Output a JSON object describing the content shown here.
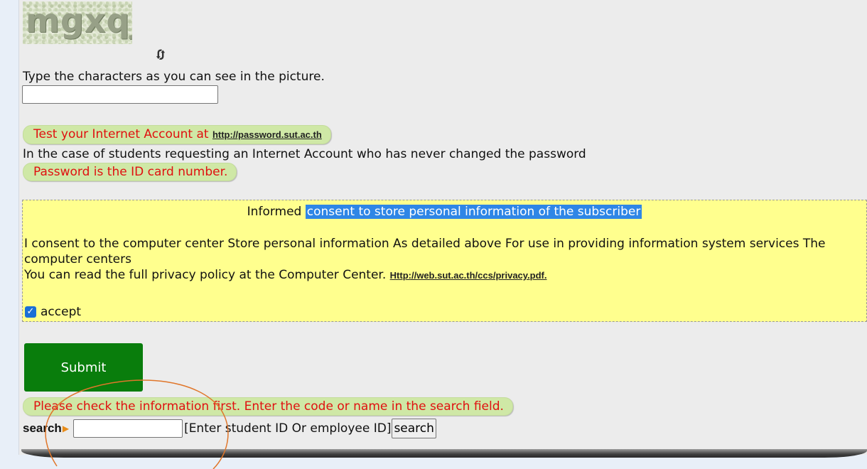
{
  "captcha": {
    "image_text": "mgxqj",
    "refresh_icon": "refresh-icon",
    "instruction": "Type the characters as you can see in the picture.",
    "input_value": ""
  },
  "notices": {
    "test_account_prefix": "Test your Internet Account at",
    "test_account_link": "http://password.sut.ac.th",
    "students_case": "In the case of students requesting an Internet Account who has never changed the password",
    "password_hint": "Password is the ID card number."
  },
  "consent": {
    "title_prefix": "Informed",
    "title_highlight": "consent to store personal information of the subscriber",
    "body_line1": "I consent to the computer center Store personal information As detailed above For use in providing information system services The computer centers",
    "body_line2_prefix": "You can read the full privacy policy at the Computer Center.",
    "privacy_link": "Http://web.sut.ac.th/ccs/privacy.pdf.",
    "accept_label": "accept",
    "accept_checked": true
  },
  "form": {
    "submit_label": "Submit",
    "check_notice": "Please check the information first. Enter the code or name in the search field."
  },
  "search": {
    "label": "search",
    "input_value": "",
    "hint": "[Enter student ID Or employee ID]",
    "button_label": "search"
  },
  "colors": {
    "pill_bg": "#cfe8a6",
    "pill_text": "#e01010",
    "consent_bg": "#ffff8e",
    "highlight": "#2f86e6",
    "submit_bg": "#097d0c",
    "annotation": "#e0762a"
  }
}
